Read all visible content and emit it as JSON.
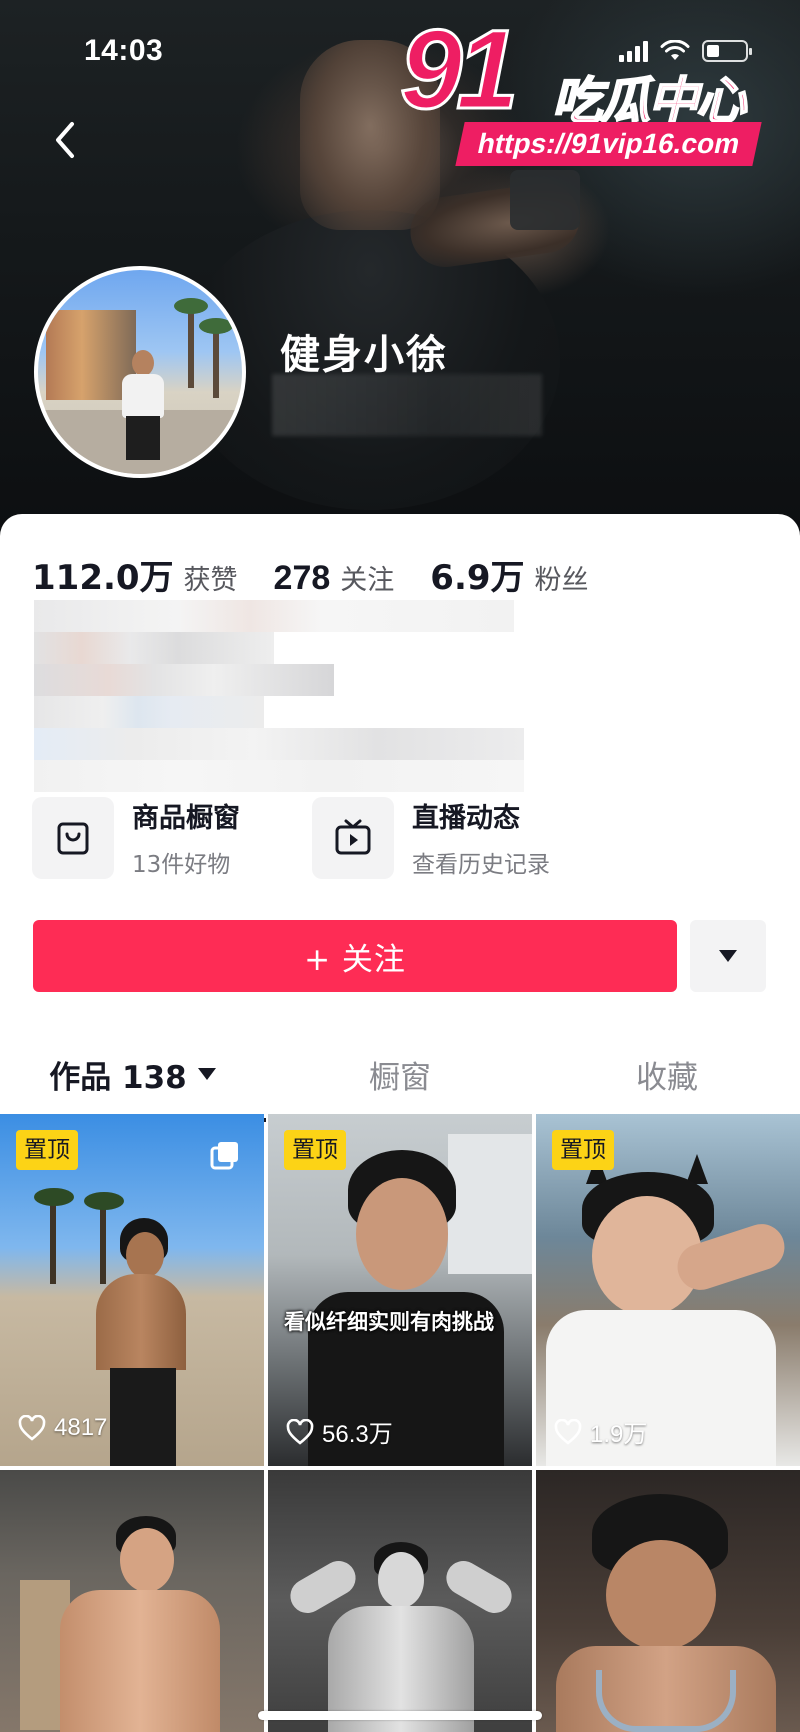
{
  "status_bar": {
    "time": "14:03"
  },
  "watermark": {
    "number": "91",
    "text": "吃瓜中心",
    "url": "https://91vip16.com"
  },
  "profile": {
    "username": "健身小徐"
  },
  "stats": [
    {
      "value": "112.0万",
      "label": "获赞"
    },
    {
      "value": "278",
      "label": "关注"
    },
    {
      "value": "6.9万",
      "label": "粉丝"
    }
  ],
  "shortcuts": [
    {
      "title": "商品橱窗",
      "subtitle": "13件好物",
      "icon": "shopping-bag-icon"
    },
    {
      "title": "直播动态",
      "subtitle": "查看历史记录",
      "icon": "tv-icon"
    }
  ],
  "actions": {
    "follow_label": "+ 关注",
    "more_icon": "caret-down-icon"
  },
  "tabs": [
    {
      "label": "作品 138",
      "active": true
    },
    {
      "label": "橱窗",
      "active": false
    },
    {
      "label": "收藏",
      "active": false
    }
  ],
  "videos": [
    {
      "pinned": true,
      "pin_label": "置顶",
      "likes": "4817",
      "multi_image": true,
      "caption": ""
    },
    {
      "pinned": true,
      "pin_label": "置顶",
      "likes": "56.3万",
      "multi_image": false,
      "caption": "看似纤细实则有肉挑战"
    },
    {
      "pinned": true,
      "pin_label": "置顶",
      "likes": "1.9万",
      "multi_image": false,
      "caption": ""
    },
    {
      "pinned": false,
      "pin_label": "",
      "likes": "",
      "multi_image": false,
      "caption": ""
    },
    {
      "pinned": false,
      "pin_label": "",
      "likes": "",
      "multi_image": false,
      "caption": ""
    },
    {
      "pinned": false,
      "pin_label": "",
      "likes": "",
      "multi_image": false,
      "caption": ""
    }
  ],
  "colors": {
    "accent": "#fe2c55",
    "pin_badge": "#fcd316",
    "watermark": "#ee1e63"
  }
}
